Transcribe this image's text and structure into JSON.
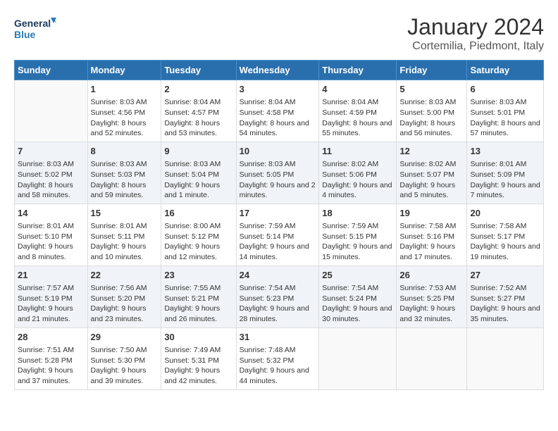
{
  "header": {
    "logo_general": "General",
    "logo_blue": "Blue",
    "month": "January 2024",
    "location": "Cortemilia, Piedmont, Italy"
  },
  "days_of_week": [
    "Sunday",
    "Monday",
    "Tuesday",
    "Wednesday",
    "Thursday",
    "Friday",
    "Saturday"
  ],
  "weeks": [
    [
      {
        "day": "",
        "sunrise": "",
        "sunset": "",
        "daylight": ""
      },
      {
        "day": "1",
        "sunrise": "Sunrise: 8:03 AM",
        "sunset": "Sunset: 4:56 PM",
        "daylight": "Daylight: 8 hours and 52 minutes."
      },
      {
        "day": "2",
        "sunrise": "Sunrise: 8:04 AM",
        "sunset": "Sunset: 4:57 PM",
        "daylight": "Daylight: 8 hours and 53 minutes."
      },
      {
        "day": "3",
        "sunrise": "Sunrise: 8:04 AM",
        "sunset": "Sunset: 4:58 PM",
        "daylight": "Daylight: 8 hours and 54 minutes."
      },
      {
        "day": "4",
        "sunrise": "Sunrise: 8:04 AM",
        "sunset": "Sunset: 4:59 PM",
        "daylight": "Daylight: 8 hours and 55 minutes."
      },
      {
        "day": "5",
        "sunrise": "Sunrise: 8:03 AM",
        "sunset": "Sunset: 5:00 PM",
        "daylight": "Daylight: 8 hours and 56 minutes."
      },
      {
        "day": "6",
        "sunrise": "Sunrise: 8:03 AM",
        "sunset": "Sunset: 5:01 PM",
        "daylight": "Daylight: 8 hours and 57 minutes."
      }
    ],
    [
      {
        "day": "7",
        "sunrise": "Sunrise: 8:03 AM",
        "sunset": "Sunset: 5:02 PM",
        "daylight": "Daylight: 8 hours and 58 minutes."
      },
      {
        "day": "8",
        "sunrise": "Sunrise: 8:03 AM",
        "sunset": "Sunset: 5:03 PM",
        "daylight": "Daylight: 8 hours and 59 minutes."
      },
      {
        "day": "9",
        "sunrise": "Sunrise: 8:03 AM",
        "sunset": "Sunset: 5:04 PM",
        "daylight": "Daylight: 9 hours and 1 minute."
      },
      {
        "day": "10",
        "sunrise": "Sunrise: 8:03 AM",
        "sunset": "Sunset: 5:05 PM",
        "daylight": "Daylight: 9 hours and 2 minutes."
      },
      {
        "day": "11",
        "sunrise": "Sunrise: 8:02 AM",
        "sunset": "Sunset: 5:06 PM",
        "daylight": "Daylight: 9 hours and 4 minutes."
      },
      {
        "day": "12",
        "sunrise": "Sunrise: 8:02 AM",
        "sunset": "Sunset: 5:07 PM",
        "daylight": "Daylight: 9 hours and 5 minutes."
      },
      {
        "day": "13",
        "sunrise": "Sunrise: 8:01 AM",
        "sunset": "Sunset: 5:09 PM",
        "daylight": "Daylight: 9 hours and 7 minutes."
      }
    ],
    [
      {
        "day": "14",
        "sunrise": "Sunrise: 8:01 AM",
        "sunset": "Sunset: 5:10 PM",
        "daylight": "Daylight: 9 hours and 8 minutes."
      },
      {
        "day": "15",
        "sunrise": "Sunrise: 8:01 AM",
        "sunset": "Sunset: 5:11 PM",
        "daylight": "Daylight: 9 hours and 10 minutes."
      },
      {
        "day": "16",
        "sunrise": "Sunrise: 8:00 AM",
        "sunset": "Sunset: 5:12 PM",
        "daylight": "Daylight: 9 hours and 12 minutes."
      },
      {
        "day": "17",
        "sunrise": "Sunrise: 7:59 AM",
        "sunset": "Sunset: 5:14 PM",
        "daylight": "Daylight: 9 hours and 14 minutes."
      },
      {
        "day": "18",
        "sunrise": "Sunrise: 7:59 AM",
        "sunset": "Sunset: 5:15 PM",
        "daylight": "Daylight: 9 hours and 15 minutes."
      },
      {
        "day": "19",
        "sunrise": "Sunrise: 7:58 AM",
        "sunset": "Sunset: 5:16 PM",
        "daylight": "Daylight: 9 hours and 17 minutes."
      },
      {
        "day": "20",
        "sunrise": "Sunrise: 7:58 AM",
        "sunset": "Sunset: 5:17 PM",
        "daylight": "Daylight: 9 hours and 19 minutes."
      }
    ],
    [
      {
        "day": "21",
        "sunrise": "Sunrise: 7:57 AM",
        "sunset": "Sunset: 5:19 PM",
        "daylight": "Daylight: 9 hours and 21 minutes."
      },
      {
        "day": "22",
        "sunrise": "Sunrise: 7:56 AM",
        "sunset": "Sunset: 5:20 PM",
        "daylight": "Daylight: 9 hours and 23 minutes."
      },
      {
        "day": "23",
        "sunrise": "Sunrise: 7:55 AM",
        "sunset": "Sunset: 5:21 PM",
        "daylight": "Daylight: 9 hours and 26 minutes."
      },
      {
        "day": "24",
        "sunrise": "Sunrise: 7:54 AM",
        "sunset": "Sunset: 5:23 PM",
        "daylight": "Daylight: 9 hours and 28 minutes."
      },
      {
        "day": "25",
        "sunrise": "Sunrise: 7:54 AM",
        "sunset": "Sunset: 5:24 PM",
        "daylight": "Daylight: 9 hours and 30 minutes."
      },
      {
        "day": "26",
        "sunrise": "Sunrise: 7:53 AM",
        "sunset": "Sunset: 5:25 PM",
        "daylight": "Daylight: 9 hours and 32 minutes."
      },
      {
        "day": "27",
        "sunrise": "Sunrise: 7:52 AM",
        "sunset": "Sunset: 5:27 PM",
        "daylight": "Daylight: 9 hours and 35 minutes."
      }
    ],
    [
      {
        "day": "28",
        "sunrise": "Sunrise: 7:51 AM",
        "sunset": "Sunset: 5:28 PM",
        "daylight": "Daylight: 9 hours and 37 minutes."
      },
      {
        "day": "29",
        "sunrise": "Sunrise: 7:50 AM",
        "sunset": "Sunset: 5:30 PM",
        "daylight": "Daylight: 9 hours and 39 minutes."
      },
      {
        "day": "30",
        "sunrise": "Sunrise: 7:49 AM",
        "sunset": "Sunset: 5:31 PM",
        "daylight": "Daylight: 9 hours and 42 minutes."
      },
      {
        "day": "31",
        "sunrise": "Sunrise: 7:48 AM",
        "sunset": "Sunset: 5:32 PM",
        "daylight": "Daylight: 9 hours and 44 minutes."
      },
      {
        "day": "",
        "sunrise": "",
        "sunset": "",
        "daylight": ""
      },
      {
        "day": "",
        "sunrise": "",
        "sunset": "",
        "daylight": ""
      },
      {
        "day": "",
        "sunrise": "",
        "sunset": "",
        "daylight": ""
      }
    ]
  ]
}
